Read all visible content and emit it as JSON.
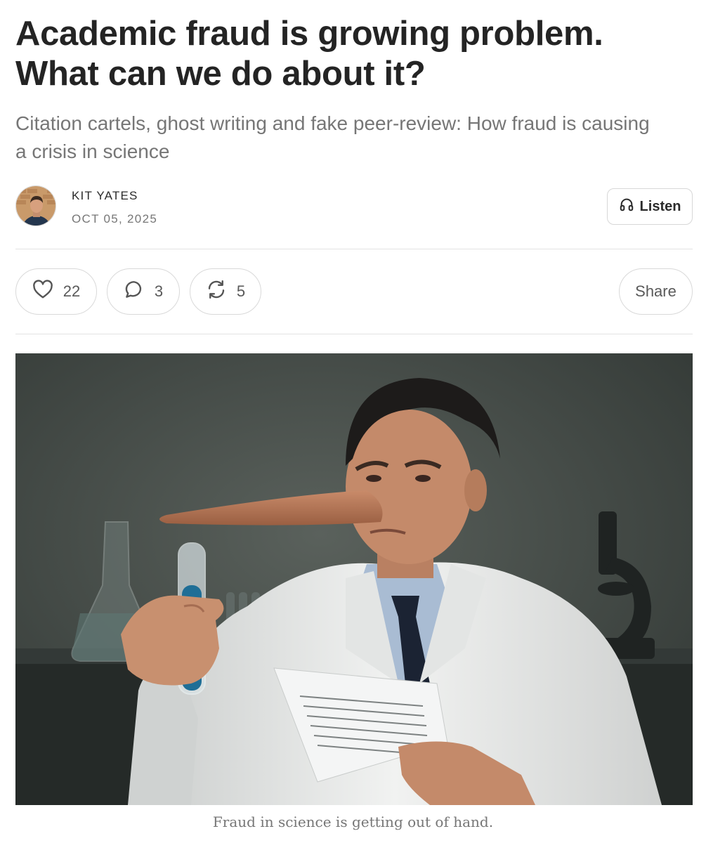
{
  "article": {
    "title": "Academic fraud is growing problem. What can we do about it?",
    "subtitle": "Citation cartels, ghost writing and fake peer-review: How fraud is causing a crisis in science"
  },
  "byline": {
    "author": "KIT YATES",
    "date": "OCT 05, 2025",
    "listen_label": "Listen",
    "avatar_icon": "author-avatar"
  },
  "actions": {
    "likes": "22",
    "comments": "3",
    "restacks": "5",
    "share_label": "Share",
    "like_icon": "heart-icon",
    "comment_icon": "comment-icon",
    "restack_icon": "restack-icon"
  },
  "hero": {
    "caption": "Fraud in science is getting out of hand.",
    "colors": {
      "background": "#3e4440",
      "coat": "#eef0ee",
      "tube_liquid": "#1f6e96",
      "nose": "#b97a5a"
    }
  }
}
